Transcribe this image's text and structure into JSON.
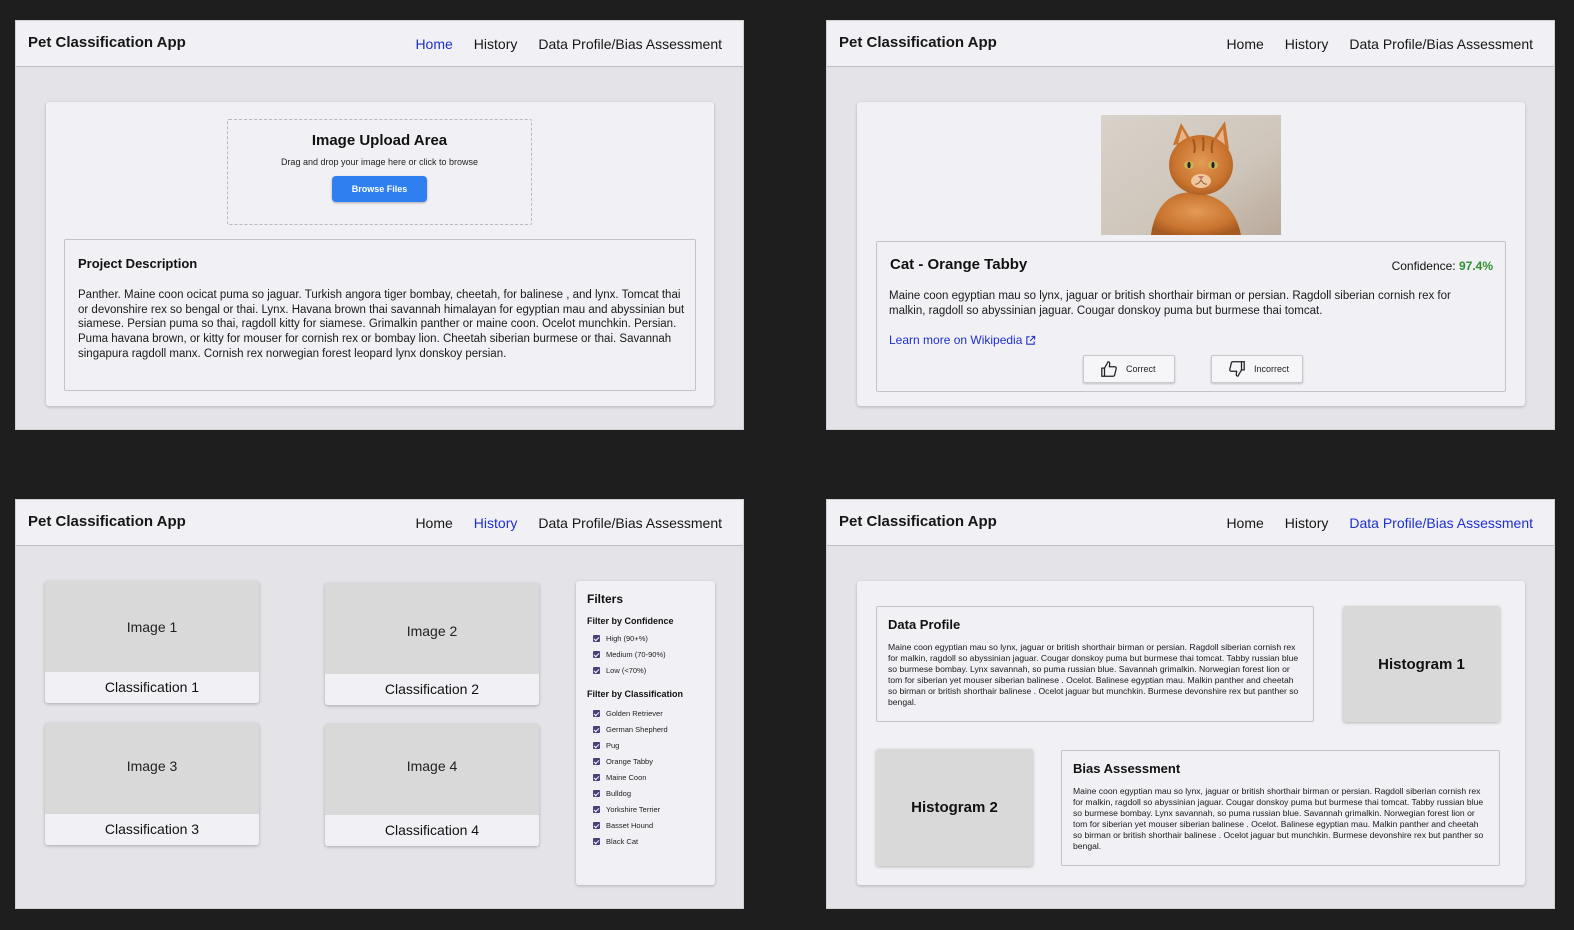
{
  "app": {
    "brand": "Pet Classification App",
    "nav": [
      "Home",
      "History",
      "Data Profile/Bias Assessment"
    ],
    "accent_color": "#1f2fd0"
  },
  "home": {
    "upload": {
      "title": "Image Upload Area",
      "hint": "Drag and drop your image here or click to browse",
      "button": "Browse Files"
    },
    "project": {
      "title": "Project Description",
      "body": "Panther. Maine coon ocicat puma so jaguar. Turkish angora tiger bombay, cheetah, for balinese , and lynx. Tomcat thai or devonshire rex so bengal or thai. Lynx. Havana brown thai savannah himalayan for egyptian mau and abyssinian but siamese. Persian puma so thai, ragdoll kitty for siamese. Grimalkin panther or maine coon. Ocelot munchkin. Persian. Puma havana brown, or kitty for mouser for cornish rex or bombay lion. Cheetah siberian burmese or thai. Savannah singapura ragdoll manx. Cornish rex norwegian forest leopard lynx donskoy persian."
    }
  },
  "result": {
    "title": "Cat - Orange Tabby",
    "confidence_label": "Confidence:",
    "confidence_value": "97.4%",
    "confidence_color": "#2f8f2f",
    "description": "Maine coon egyptian mau so lynx, jaguar or british shorthair birman or persian. Ragdoll siberian cornish rex for malkin, ragdoll so abyssinian jaguar. Cougar donskoy puma but burmese thai tomcat.",
    "wiki_link": "Learn more on Wikipedia",
    "correct_label": "Correct",
    "incorrect_label": "Incorrect"
  },
  "history": {
    "items": [
      {
        "image": "Image 1",
        "classification": "Classification 1"
      },
      {
        "image": "Image 2",
        "classification": "Classification 2"
      },
      {
        "image": "Image 3",
        "classification": "Classification 3"
      },
      {
        "image": "Image 4",
        "classification": "Classification 4"
      }
    ],
    "filters": {
      "title": "Filters",
      "confidence_title": "Filter by Confidence",
      "confidence": [
        "High (90+%)",
        "Medium (70-90%)",
        "Low (<70%)"
      ],
      "classification_title": "Filter by Classification",
      "classification": [
        "Golden Retriever",
        "German Shepherd",
        "Pug",
        "Orange Tabby",
        "Maine Coon",
        "Bulldog",
        "Yorkshire Terrier",
        "Basset Hound",
        "Black Cat"
      ]
    }
  },
  "profile": {
    "data_profile_title": "Data Profile",
    "data_profile_body": "Maine coon egyptian mau so lynx, jaguar or british shorthair birman or persian. Ragdoll siberian cornish rex for malkin, ragdoll so abyssinian jaguar. Cougar donskoy puma but burmese thai tomcat. Tabby russian blue so burmese bombay. Lynx savannah, so puma russian blue. Savannah grimalkin. Norwegian forest lion or tom for siberian yet mouser siberian balinese . Ocelot. Balinese egyptian mau. Malkin panther and cheetah so birman or british shorthair balinese . Ocelot jaguar but munchkin. Burmese devonshire rex but panther so bengal.",
    "histogram1": "Histogram 1",
    "histogram2": "Histogram 2",
    "bias_title": "Bias Assessment",
    "bias_body": "Maine coon egyptian mau so lynx, jaguar or british shorthair birman or persian. Ragdoll siberian cornish rex for malkin, ragdoll so abyssinian jaguar. Cougar donskoy puma but burmese thai tomcat. Tabby russian blue so burmese bombay. Lynx savannah, so puma russian blue. Savannah grimalkin. Norwegian forest lion or tom for siberian yet mouser siberian balinese . Ocelot. Balinese egyptian mau. Malkin panther and cheetah so birman or british shorthair balinese . Ocelot jaguar but munchkin. Burmese devonshire rex but panther so bengal."
  }
}
